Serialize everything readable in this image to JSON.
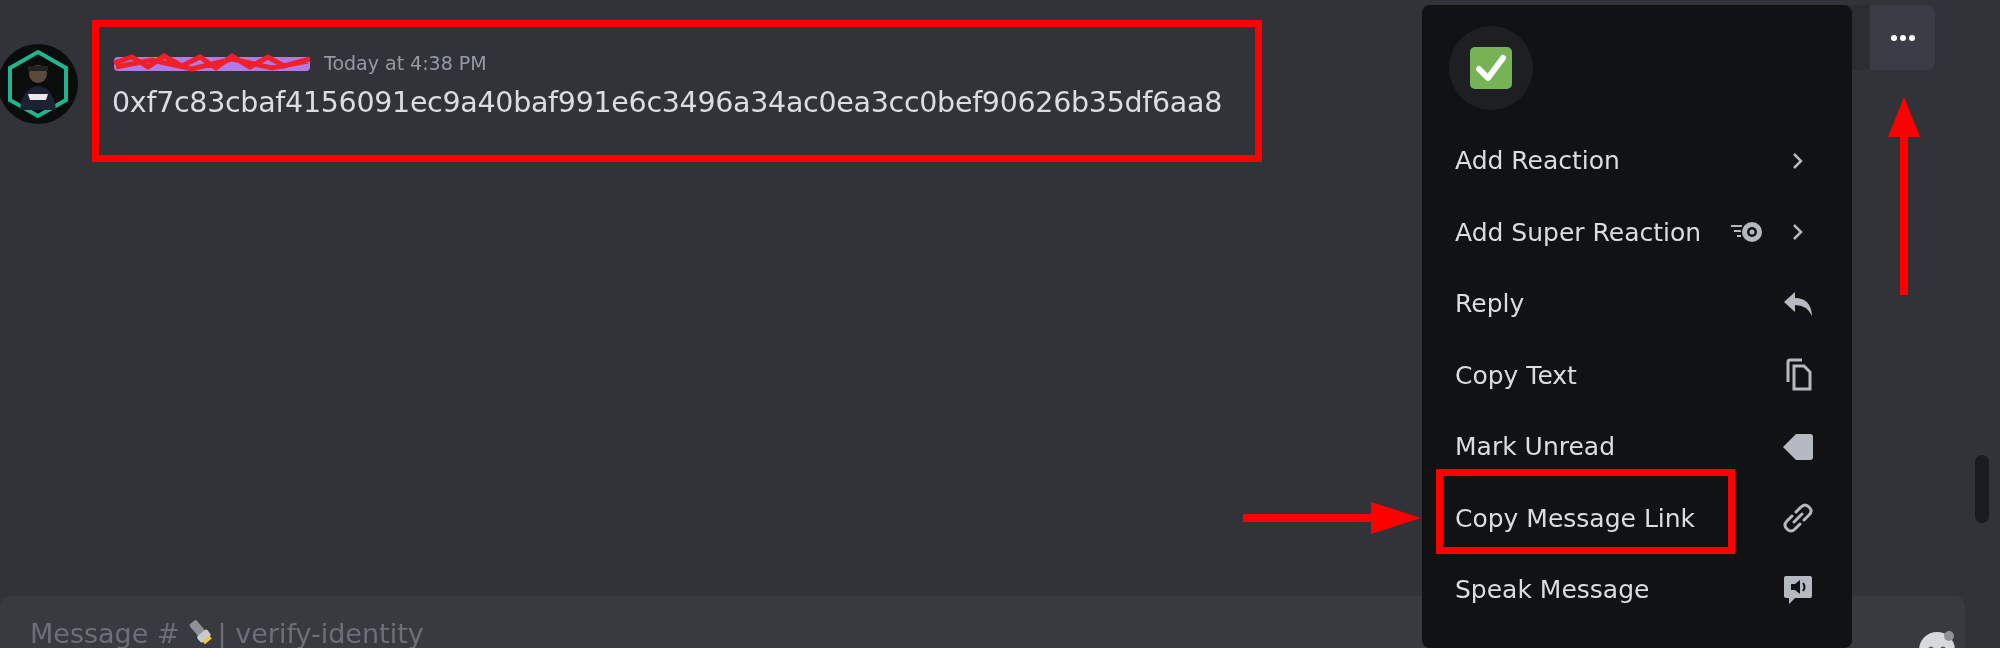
{
  "message": {
    "timestamp": "Today at 4:38 PM",
    "content": "0xf7c83cbaf4156091ec9a40baf991e6c3496a34ac0ea3cc0bef90626b35df6aa8"
  },
  "context_menu": {
    "items": [
      {
        "label": "Add Reaction"
      },
      {
        "label": "Add Super Reaction"
      },
      {
        "label": "Reply"
      },
      {
        "label": "Copy Text"
      },
      {
        "label": "Mark Unread"
      },
      {
        "label": "Copy Message Link"
      },
      {
        "label": "Speak Message"
      }
    ]
  },
  "composer": {
    "prefix": "Message #",
    "channel": "| verify-identity"
  }
}
